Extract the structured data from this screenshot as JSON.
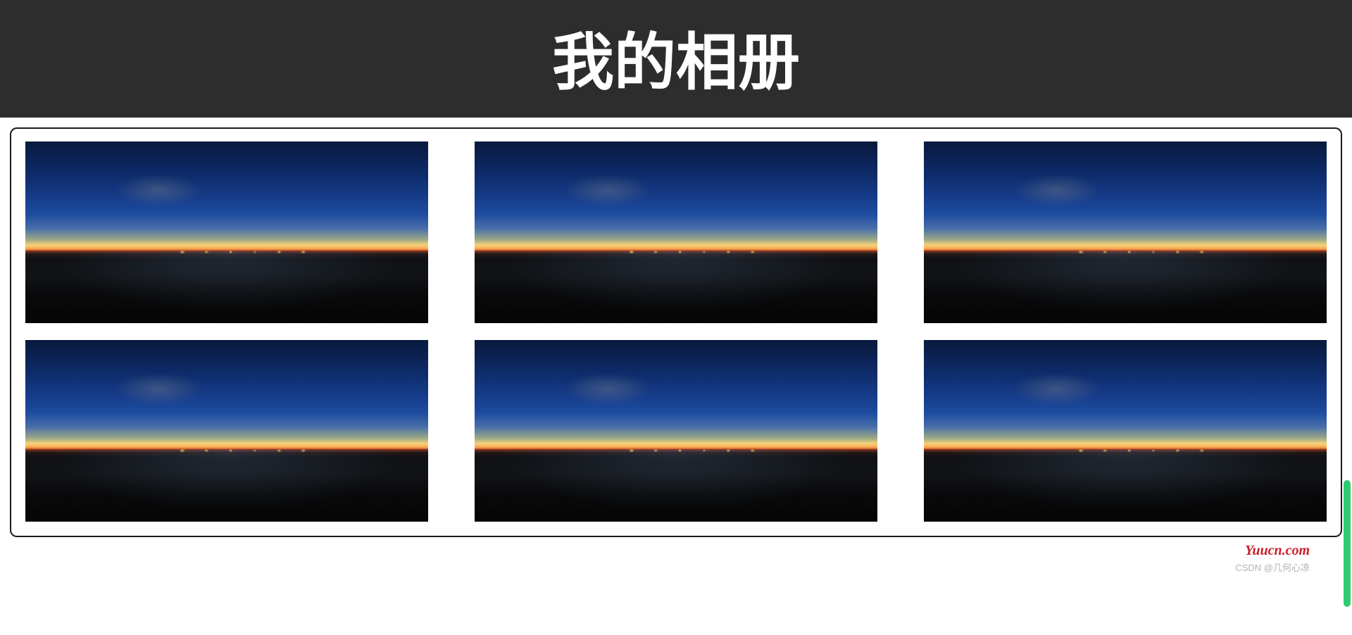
{
  "header": {
    "title": "我的相册"
  },
  "gallery": {
    "items": [
      {
        "alt": "sunset-landscape-1"
      },
      {
        "alt": "sunset-landscape-2"
      },
      {
        "alt": "sunset-landscape-3"
      },
      {
        "alt": "sunset-landscape-4"
      },
      {
        "alt": "sunset-landscape-5"
      },
      {
        "alt": "sunset-landscape-6"
      }
    ]
  },
  "footer": {
    "watermark_main": "Yuucn.com",
    "watermark_sub": "CSDN @几何心凉"
  }
}
